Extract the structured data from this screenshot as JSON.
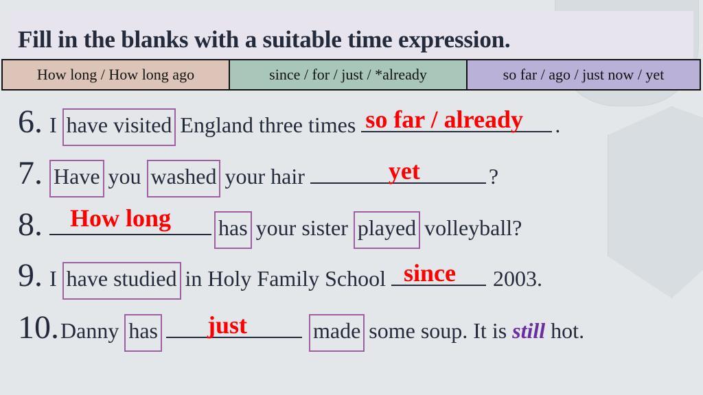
{
  "title": "Fill in the blanks with a suitable time expression.",
  "hints": [
    {
      "label": "How long / How long ago",
      "color": "#dcc5b8"
    },
    {
      "label": "since / for / just / *already",
      "color": "#a8c6b9"
    },
    {
      "label": "so far / ago / just now / yet",
      "color": "#b9b1d8"
    }
  ],
  "colors": {
    "text": "#232a3b",
    "answer": "#ff0000",
    "box_border": "#a05ea2",
    "emphasis": "#6a2ea0"
  },
  "questions": [
    {
      "number": "6.",
      "parts": {
        "p1": "I",
        "boxed1": "have visited",
        "p2": "England three times",
        "answer": "so far / already",
        "end": "."
      }
    },
    {
      "number": "7.",
      "parts": {
        "boxed1": "Have",
        "p1": "you",
        "boxed2": "washed",
        "p2": "your hair",
        "answer": "yet",
        "end": "?"
      }
    },
    {
      "number": "8.",
      "parts": {
        "answer": "How long",
        "boxed1": "has",
        "p1": "your sister",
        "boxed2": "played",
        "p2": "volleyball?"
      }
    },
    {
      "number": "9.",
      "parts": {
        "p1": "I",
        "boxed1": "have studied",
        "p2": "in Holy Family School",
        "answer": "since",
        "end": "2003."
      }
    },
    {
      "number": "10.",
      "parts": {
        "p1": "Danny",
        "boxed1": "has",
        "answer": "just",
        "boxed2": "made",
        "p2": "some soup. It is",
        "emphasis": "still",
        "end": "hot."
      }
    }
  ]
}
